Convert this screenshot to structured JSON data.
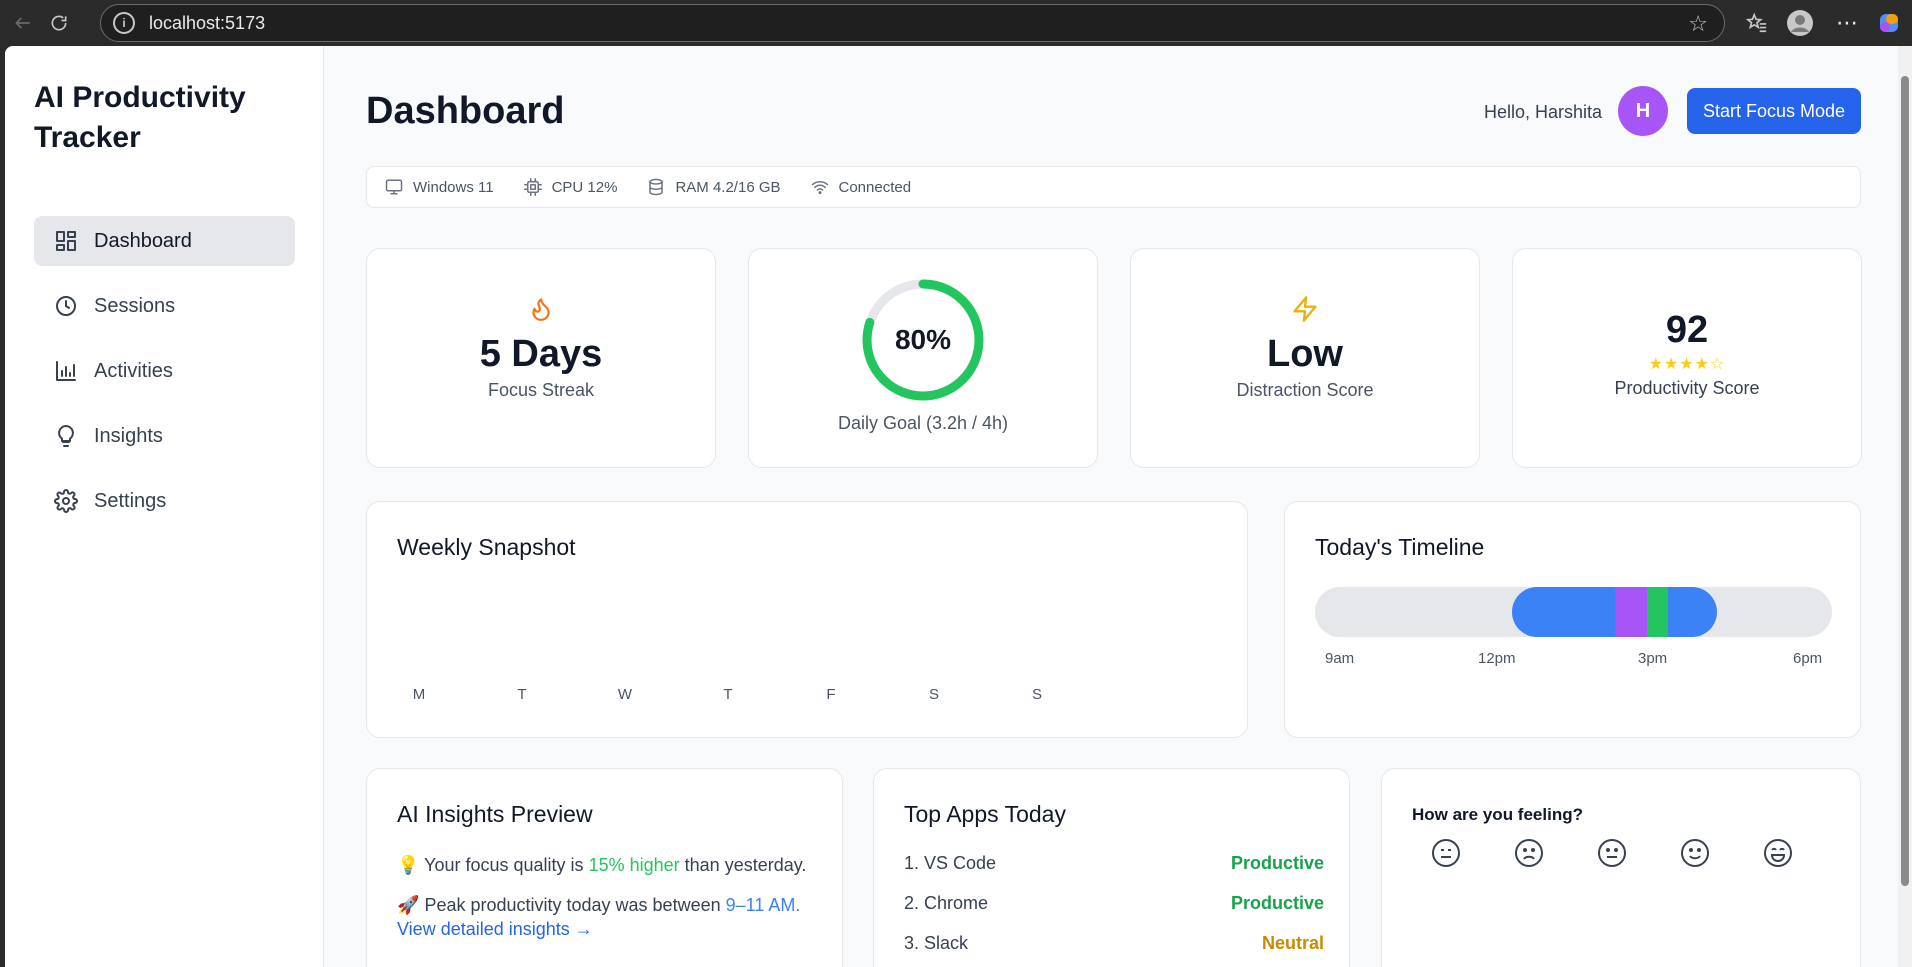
{
  "browser": {
    "url": "localhost:5173"
  },
  "sidebar": {
    "brand": "AI Productivity Tracker",
    "items": [
      {
        "label": "Dashboard",
        "icon": "dashboard-icon",
        "active": true
      },
      {
        "label": "Sessions",
        "icon": "clock-icon"
      },
      {
        "label": "Activities",
        "icon": "bar-chart-icon"
      },
      {
        "label": "Insights",
        "icon": "lightbulb-icon"
      },
      {
        "label": "Settings",
        "icon": "gear-icon"
      }
    ]
  },
  "header": {
    "title": "Dashboard",
    "greeting": "Hello, Harshita",
    "avatar_initial": "H",
    "focus_button": "Start Focus Mode"
  },
  "system": {
    "os": "Windows 11",
    "cpu": "CPU 12%",
    "ram": "RAM 4.2/16 GB",
    "network": "Connected"
  },
  "stats": {
    "streak": {
      "value": "5 Days",
      "label": "Focus Streak",
      "icon": "flame-icon"
    },
    "goal": {
      "percent_text": "80%",
      "progress": 0.8,
      "label": "Daily Goal (3.2h / 4h)"
    },
    "distraction": {
      "value": "Low",
      "label": "Distraction Score",
      "icon": "lightning-icon"
    },
    "productivity": {
      "value": "92",
      "stars": "★★★★☆",
      "rating": 4,
      "label": "Productivity Score"
    }
  },
  "weekly": {
    "title": "Weekly Snapshot",
    "days": [
      "M",
      "T",
      "W",
      "T",
      "F",
      "S",
      "S"
    ]
  },
  "timeline": {
    "title": "Today's Timeline",
    "ticks": [
      "9am",
      "12pm",
      "3pm",
      "6pm"
    ],
    "colors": {
      "track": "#e5e7eb",
      "focus": "#3b82f6",
      "break": "#a855f7",
      "active": "#22c55e"
    }
  },
  "insights": {
    "title": "AI Insights Preview",
    "line1": {
      "icon": "💡",
      "pre": "Your focus quality is",
      "highlight": "15% higher",
      "post": "than yesterday."
    },
    "line2": {
      "icon": "🚀",
      "pre": "Peak productivity today was between",
      "highlight": "9–11 AM."
    },
    "link": "View detailed insights →"
  },
  "top_apps": {
    "title": "Top Apps Today",
    "apps": [
      {
        "name": "1. VS Code",
        "tag": "Productive",
        "color": "#16a34a"
      },
      {
        "name": "2. Chrome",
        "tag": "Productive",
        "color": "#16a34a"
      },
      {
        "name": "3. Slack",
        "tag": "Neutral",
        "color": "#ca8a04"
      }
    ]
  },
  "mood": {
    "title": "How are you feeling?",
    "options": [
      "neutral-face-icon",
      "sad-face-icon",
      "meh-face-icon",
      "smile-face-icon",
      "grin-face-icon"
    ]
  },
  "accent": "#2563eb"
}
